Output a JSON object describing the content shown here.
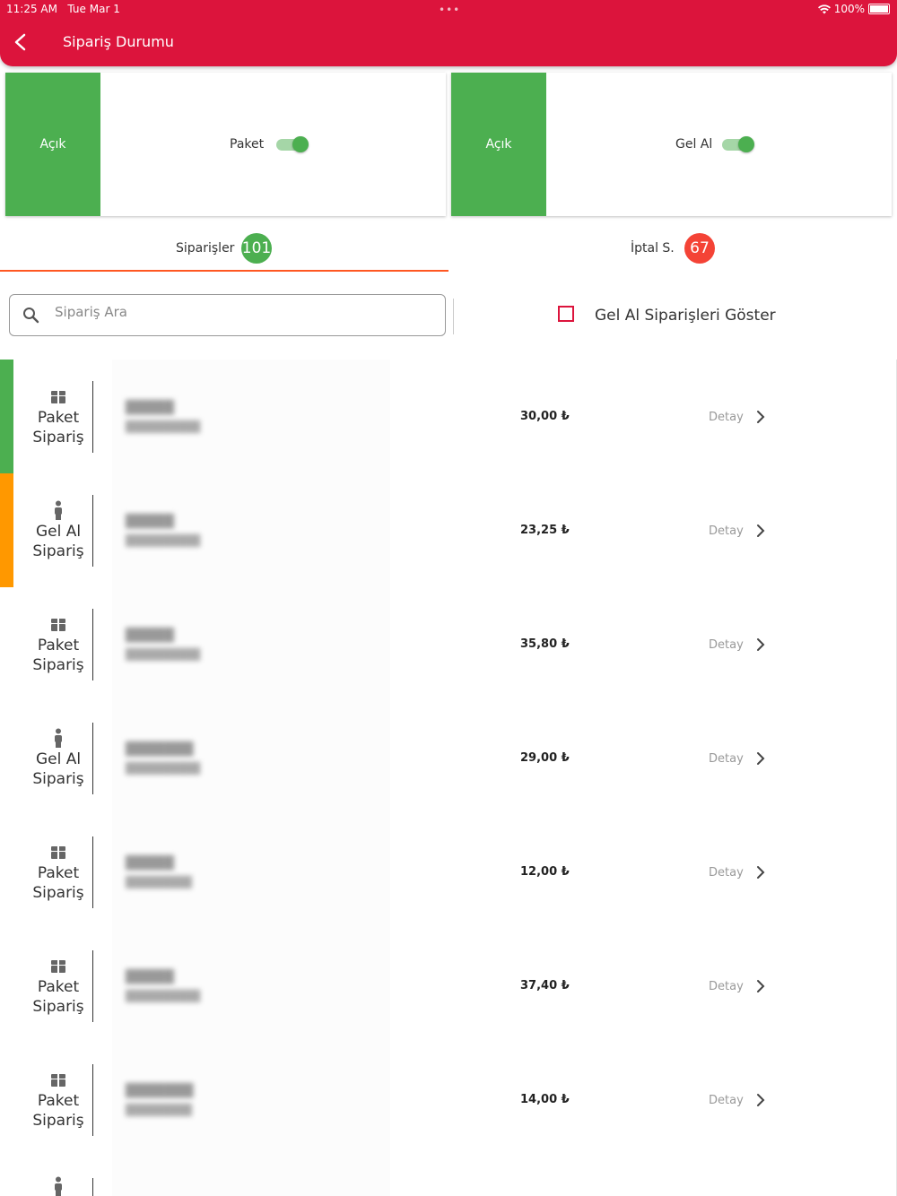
{
  "status_bar": {
    "time": "11:25 AM",
    "date": "Tue Mar 1",
    "dots": "•••",
    "battery": "100%"
  },
  "header": {
    "title": "Sipariş Durumu",
    "bg_color": "#dc143c"
  },
  "status_cards": [
    {
      "state": "Açık",
      "label": "Paket",
      "toggle_on": true
    },
    {
      "state": "Açık",
      "label": "Gel Al",
      "toggle_on": true
    }
  ],
  "tabs": [
    {
      "label": "Siparişler",
      "count": "101",
      "badge_color": "#4caf50",
      "active": true
    },
    {
      "label": "İptal S.",
      "count": "67",
      "badge_color": "#f44336",
      "active": false
    }
  ],
  "search": {
    "placeholder": "Sipariş Ara",
    "value": ""
  },
  "filter": {
    "label": "Gel Al  Siparişleri Göster",
    "checked": false
  },
  "orders": [
    {
      "type_line1": "Paket",
      "type_line2": "Sipariş",
      "icon": "package-icon",
      "bar_color": "#4caf50",
      "price": "30,00 ₺",
      "detail_label": "Detay"
    },
    {
      "type_line1": "Gel Al",
      "type_line2": "Sipariş",
      "icon": "person-icon",
      "bar_color": "#ff9800",
      "price": "23,25 ₺",
      "detail_label": "Detay"
    },
    {
      "type_line1": "Paket",
      "type_line2": "Sipariş",
      "icon": "package-icon",
      "bar_color": "",
      "price": "35,80 ₺",
      "detail_label": "Detay"
    },
    {
      "type_line1": "Gel Al",
      "type_line2": "Sipariş",
      "icon": "person-icon",
      "bar_color": "",
      "price": "29,00 ₺",
      "detail_label": "Detay"
    },
    {
      "type_line1": "Paket",
      "type_line2": "Sipariş",
      "icon": "package-icon",
      "bar_color": "",
      "price": "12,00 ₺",
      "detail_label": "Detay"
    },
    {
      "type_line1": "Paket",
      "type_line2": "Sipariş",
      "icon": "package-icon",
      "bar_color": "",
      "price": "37,40 ₺",
      "detail_label": "Detay"
    },
    {
      "type_line1": "Paket",
      "type_line2": "Sipariş",
      "icon": "package-icon",
      "bar_color": "",
      "price": "14,00 ₺",
      "detail_label": "Detay"
    },
    {
      "type_line1": "",
      "type_line2": "",
      "icon": "person-icon",
      "bar_color": "",
      "price": "",
      "detail_label": ""
    }
  ]
}
